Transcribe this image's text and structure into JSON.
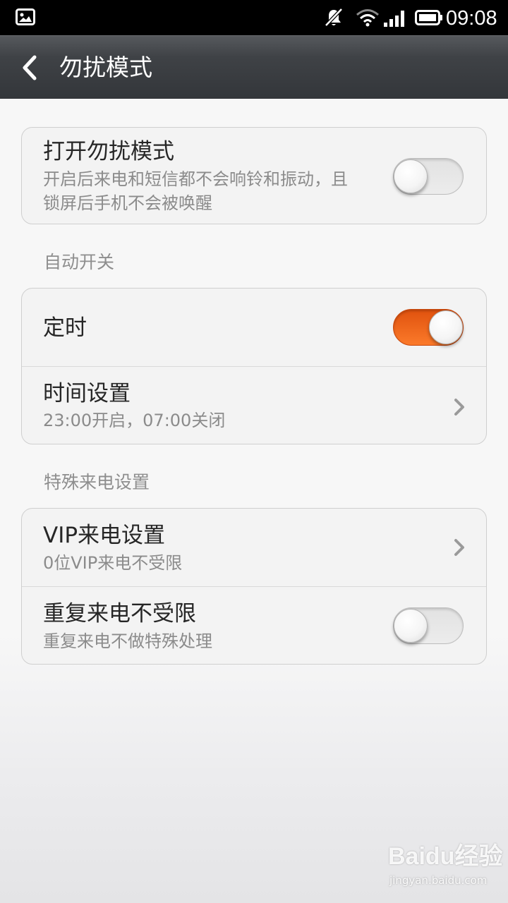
{
  "status_bar": {
    "time": "09:08",
    "icons": [
      "gallery-icon",
      "silent-mode-icon",
      "wifi-icon",
      "signal-icon",
      "battery-icon"
    ]
  },
  "header": {
    "title": "勿扰模式",
    "back_icon": "back-arrow-icon"
  },
  "dnd_card": {
    "title": "打开勿扰模式",
    "subtitle_line1": "开启后来电和短信都不会响铃和振动，且",
    "subtitle_line2": "锁屏后手机不会被唤醒",
    "toggle_on": false
  },
  "auto_section": {
    "label": "自动开关",
    "schedule": {
      "title": "定时",
      "toggle_on": true
    },
    "time_settings": {
      "title": "时间设置",
      "subtitle": "23:00开启，07:00关闭"
    }
  },
  "special_section": {
    "label": "特殊来电设置",
    "vip": {
      "title": "VIP来电设置",
      "subtitle": "0位VIP来电不受限"
    },
    "repeat": {
      "title": "重复来电不受限",
      "subtitle": "重复来电不做特殊处理",
      "toggle_on": false
    }
  },
  "watermark": {
    "brand": "Baidu经验",
    "url": "jingyan.baidu.com"
  },
  "colors": {
    "accent": "#f26a1b",
    "title_bar": "#3a3d41",
    "background": "#f7f7f7"
  }
}
